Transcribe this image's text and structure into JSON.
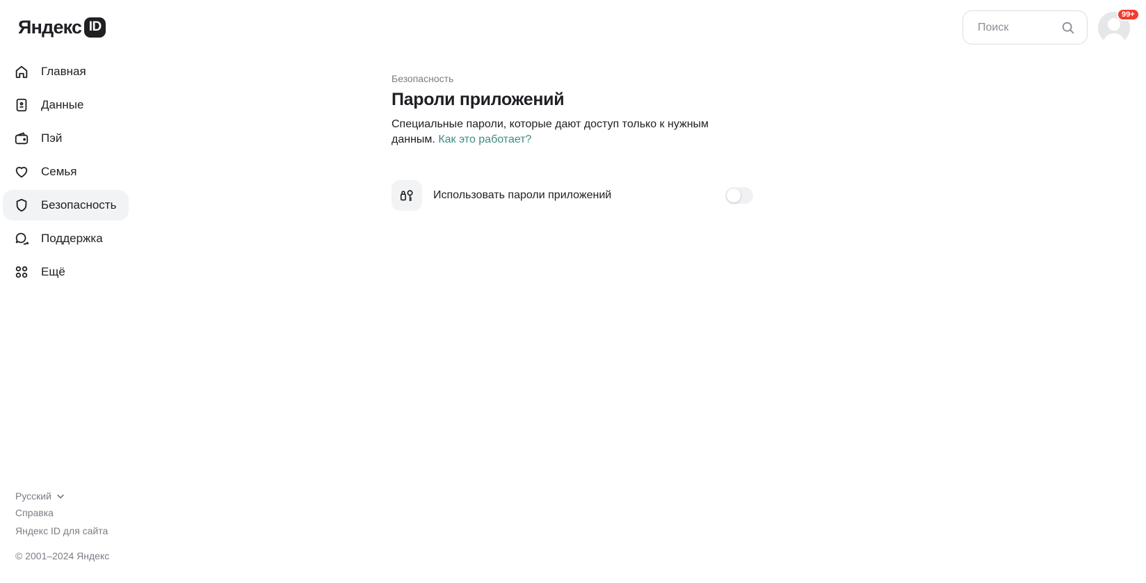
{
  "logo": {
    "text": "Яндекс",
    "badge": "ID"
  },
  "sidebar": {
    "items": [
      {
        "label": "Главная",
        "icon": "home-icon"
      },
      {
        "label": "Данные",
        "icon": "id-card-icon"
      },
      {
        "label": "Пэй",
        "icon": "wallet-icon"
      },
      {
        "label": "Семья",
        "icon": "heart-icon"
      },
      {
        "label": "Безопасность",
        "icon": "shield-icon",
        "active": true
      },
      {
        "label": "Поддержка",
        "icon": "chat-icon"
      },
      {
        "label": "Ещё",
        "icon": "grid-icon"
      }
    ]
  },
  "search": {
    "placeholder": "Поиск",
    "value": ""
  },
  "avatar": {
    "badge": "99+"
  },
  "main": {
    "breadcrumb": "Безопасность",
    "title": "Пароли приложений",
    "description": "Специальные пароли, которые дают доступ только к нужным данным.",
    "link": "Как это работает?"
  },
  "setting": {
    "label": "Использовать пароли приложений",
    "icon": "key-lock-icon",
    "enabled": false
  },
  "footer": {
    "language": "Русский",
    "help": "Справка",
    "for_sites": "Яндекс ID для сайта",
    "copyright": "© 2001–2024 Яндекс"
  },
  "colors": {
    "accent_link": "#3f8a80",
    "badge": "#f23b2f",
    "active_bg": "#f2f3f5"
  }
}
